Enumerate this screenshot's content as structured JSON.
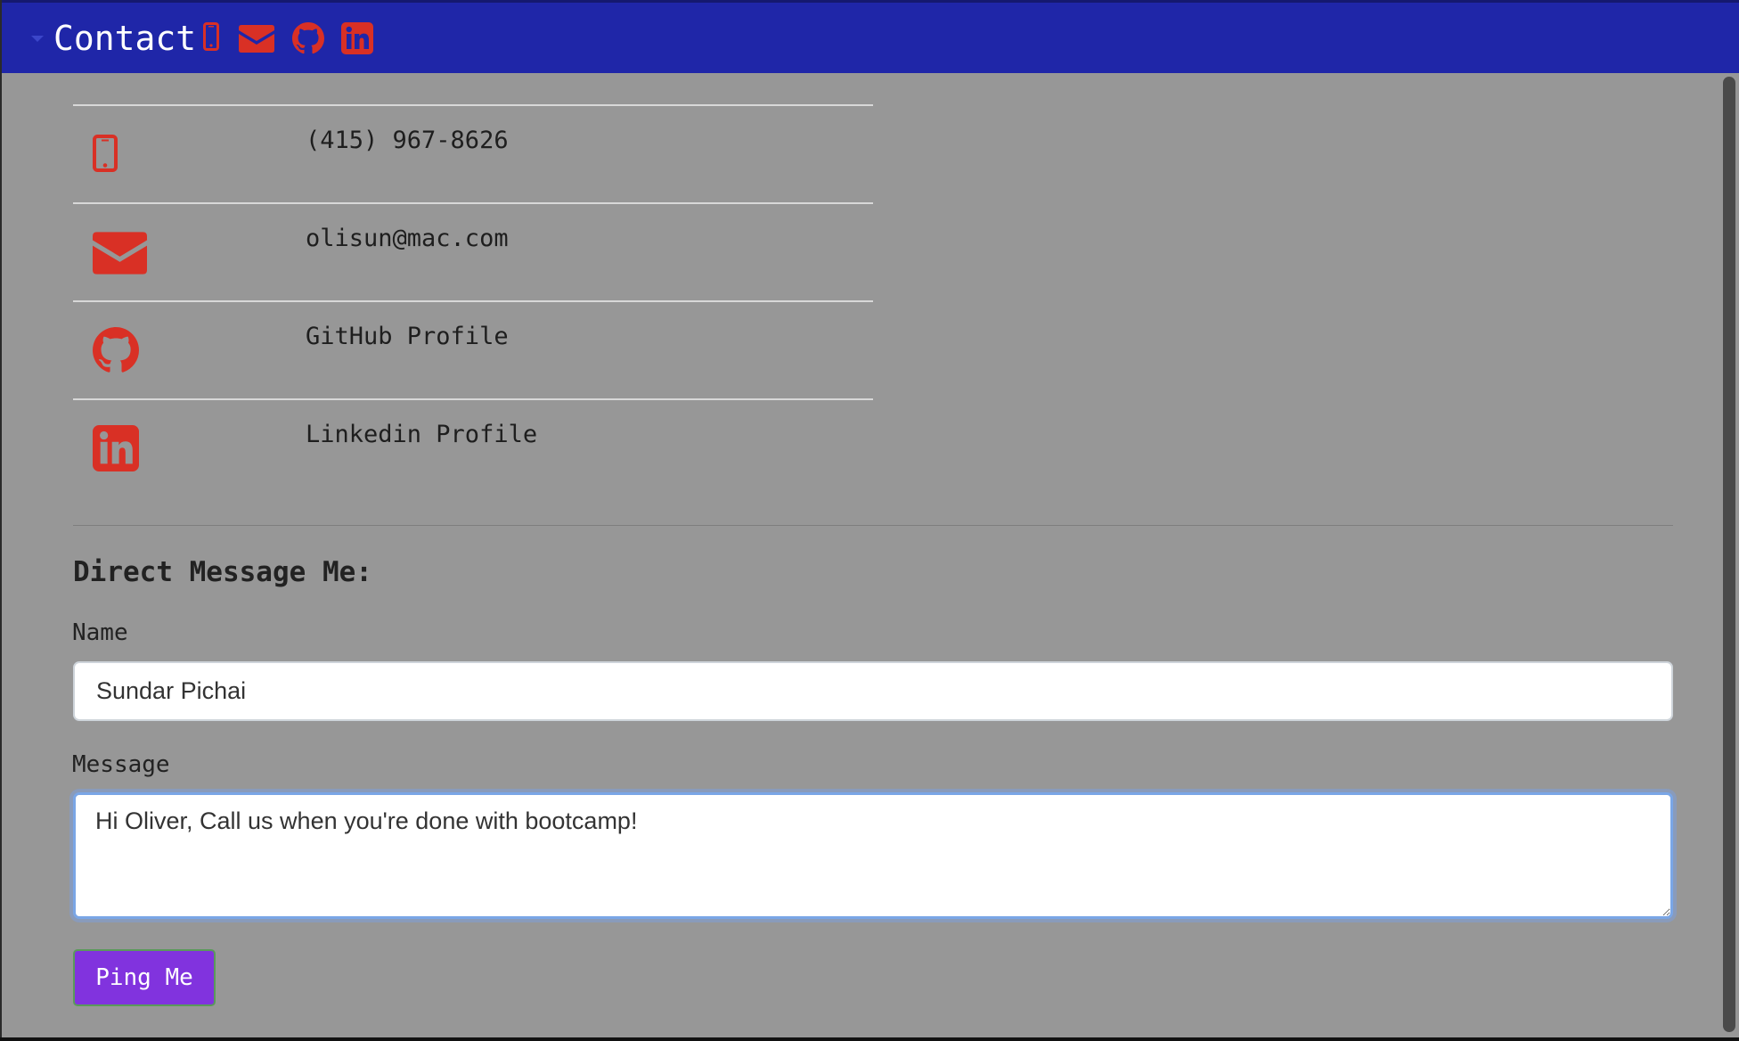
{
  "header": {
    "title": "Contact",
    "icons": [
      "phone-icon",
      "envelope-icon",
      "github-icon",
      "linkedin-icon"
    ]
  },
  "contacts": [
    {
      "icon": "phone-icon",
      "label": "(415) 967-8626"
    },
    {
      "icon": "envelope-icon",
      "label": "olisun@mac.com"
    },
    {
      "icon": "github-icon",
      "label": "GitHub Profile"
    },
    {
      "icon": "linkedin-icon",
      "label": "Linkedin Profile"
    }
  ],
  "form": {
    "heading": "Direct Message Me:",
    "name_label": "Name",
    "name_value": "Sundar Pichai",
    "message_label": "Message",
    "message_value": "Hi Oliver, Call us when you're done with bootcamp!",
    "submit_label": "Ping Me"
  },
  "colors": {
    "header_bg": "#1f26a8",
    "icon_red": "#d93025",
    "page_bg": "#979797",
    "button_bg": "#8133de"
  }
}
